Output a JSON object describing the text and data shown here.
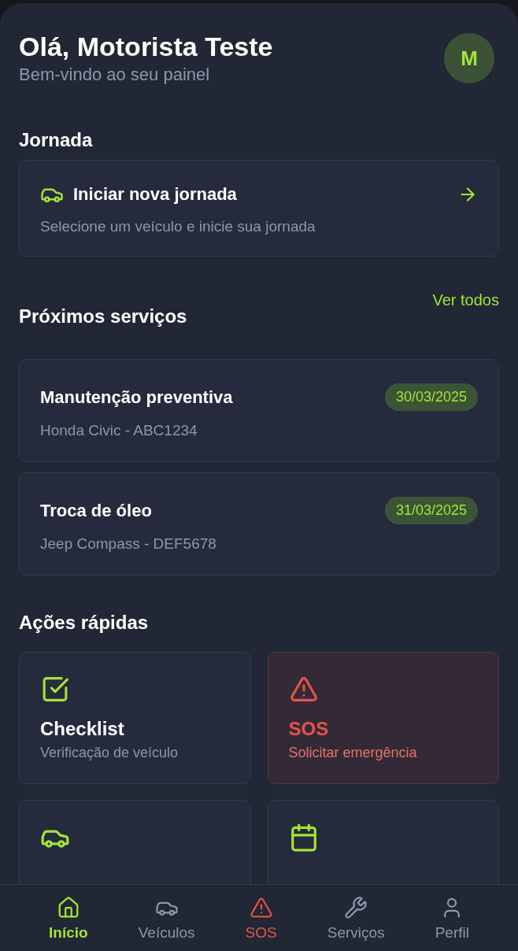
{
  "header": {
    "title": "Olá, Motorista Teste",
    "subtitle": "Bem-vindo ao seu painel",
    "avatar": "M"
  },
  "journey": {
    "heading": "Jornada",
    "title": "Iniciar nova jornada",
    "subtitle": "Selecione um veículo e inicie sua jornada"
  },
  "services": {
    "heading": "Próximos serviços",
    "link": "Ver todos",
    "items": [
      {
        "title": "Manutenção preventiva",
        "vehicle": "Honda Civic - ABC1234",
        "date": "30/03/2025"
      },
      {
        "title": "Troca de óleo",
        "vehicle": "Jeep Compass - DEF5678",
        "date": "31/03/2025"
      }
    ]
  },
  "quick_actions": {
    "heading": "Ações rápidas",
    "items": [
      {
        "kind": "normal",
        "title": "Checklist",
        "subtitle": "Verificação de veículo"
      },
      {
        "kind": "alert",
        "title": "SOS",
        "subtitle": "Solicitar emergência"
      },
      {
        "kind": "normal"
      },
      {
        "kind": "normal"
      }
    ]
  },
  "bottom_nav": [
    {
      "label": "Início",
      "selected": true,
      "kind": "normal"
    },
    {
      "label": "Veículos",
      "selected": false,
      "kind": "normal"
    },
    {
      "label": "SOS",
      "selected": false,
      "kind": "alert"
    },
    {
      "label": "Serviços",
      "selected": false,
      "kind": "normal"
    },
    {
      "label": "Perfil",
      "selected": false,
      "kind": "normal"
    }
  ]
}
